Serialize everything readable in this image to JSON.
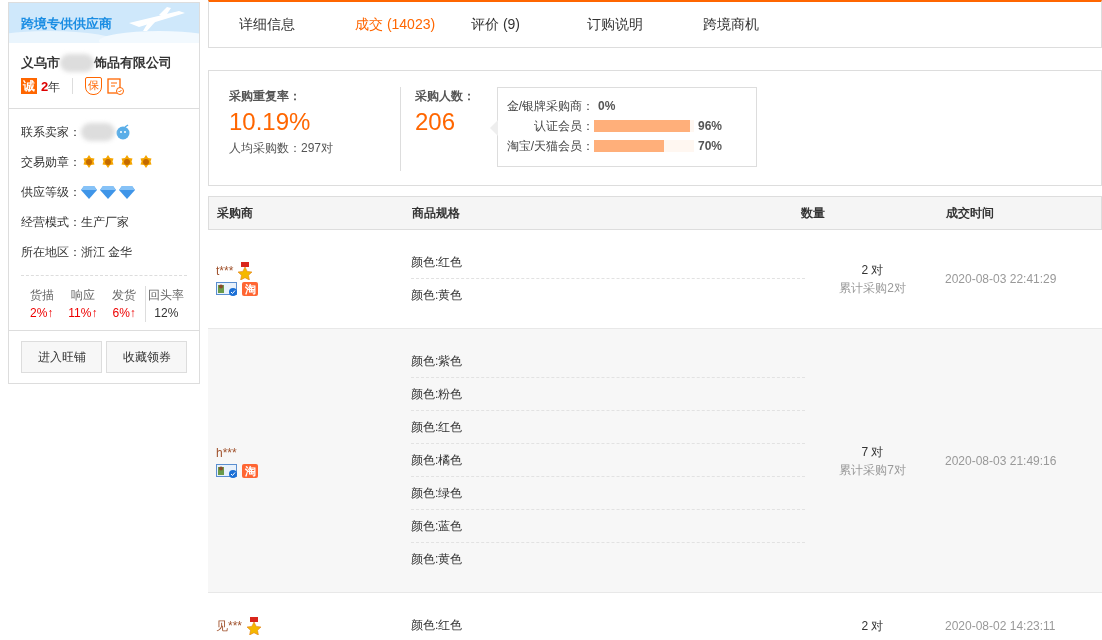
{
  "sidebar": {
    "banner": "跨境专供供应商",
    "company_start": "义乌市",
    "company_end": "饰品有限公司",
    "cert_badge": "诚",
    "years_number": "2",
    "years_unit": "年",
    "guarantee_badge": "保",
    "info": [
      {
        "label": "联系卖家：",
        "kind": "contact"
      },
      {
        "label": "交易勋章：",
        "kind": "medals",
        "icons": [
          {
            "kind": "medal"
          },
          {
            "kind": "medal"
          },
          {
            "kind": "medal"
          },
          {
            "kind": "medal"
          }
        ]
      },
      {
        "label": "供应等级：",
        "kind": "diamonds",
        "icons": [
          {
            "kind": "diamond"
          },
          {
            "kind": "diamond"
          },
          {
            "kind": "diamond"
          }
        ]
      },
      {
        "label": "经营模式：",
        "kind": "text",
        "value": "生产厂家"
      },
      {
        "label": "所在地区：",
        "kind": "text",
        "value": "浙江 金华"
      }
    ],
    "ratings": [
      {
        "label": "货描",
        "value": "2%↑",
        "rising": true
      },
      {
        "label": "响应",
        "value": "11%↑",
        "rising": true
      },
      {
        "label": "发货",
        "value": "6%↑",
        "rising": true
      },
      {
        "label": "回头率",
        "value": "12%",
        "rising": false
      }
    ],
    "buttons": [
      "进入旺铺",
      "收藏领券"
    ]
  },
  "tabs": [
    {
      "label": "详细信息",
      "selected": false
    },
    {
      "label": "成交 (14023)",
      "selected": true
    },
    {
      "label": "评价 (9)",
      "selected": false
    },
    {
      "label": "订购说明",
      "selected": false
    },
    {
      "label": "跨境商机",
      "selected": false
    }
  ],
  "stats": {
    "repeat_label": "采购重复率：",
    "repeat_value": "10.19%",
    "avg_label": "人均采购数：",
    "avg_value": "297对",
    "buyers_label": "采购人数：",
    "buyers_value": "206",
    "breakdown": [
      {
        "label": "金/银牌采购商：",
        "reading": "0%"
      },
      {
        "label": "认证会员：",
        "level": 0.96,
        "reading": "96%"
      },
      {
        "label": "淘宝/天猫会员：",
        "level": 0.7,
        "reading": "70%"
      }
    ]
  },
  "table": {
    "columns": [
      "采购商",
      "商品规格",
      "数量",
      "成交时间"
    ],
    "rows": [
      {
        "buyer": "t***",
        "medal": true,
        "badges": [
          {
            "kind": "id"
          },
          {
            "kind": "taobao",
            "label": "淘"
          }
        ],
        "specs": [
          "颜色:红色",
          "颜色:黄色"
        ],
        "qty": "2 对",
        "total": "累计采购2对",
        "time": "2020-08-03 22:41:29"
      },
      {
        "buyer": "h***",
        "medal": false,
        "badges": [
          {
            "kind": "id"
          },
          {
            "kind": "taobao",
            "label": "淘"
          }
        ],
        "specs": [
          "颜色:紫色",
          "颜色:粉色",
          "颜色:红色",
          "颜色:橘色",
          "颜色:绿色",
          "颜色:蓝色",
          "颜色:黄色"
        ],
        "qty": "7 对",
        "total": "累计采购7对",
        "time": "2020-08-03 21:49:16"
      },
      {
        "buyer": "见***",
        "medal": true,
        "specs": [
          "颜色:红色"
        ],
        "qty": "2 对",
        "time": "2020-08-02 14:23:11"
      }
    ]
  }
}
